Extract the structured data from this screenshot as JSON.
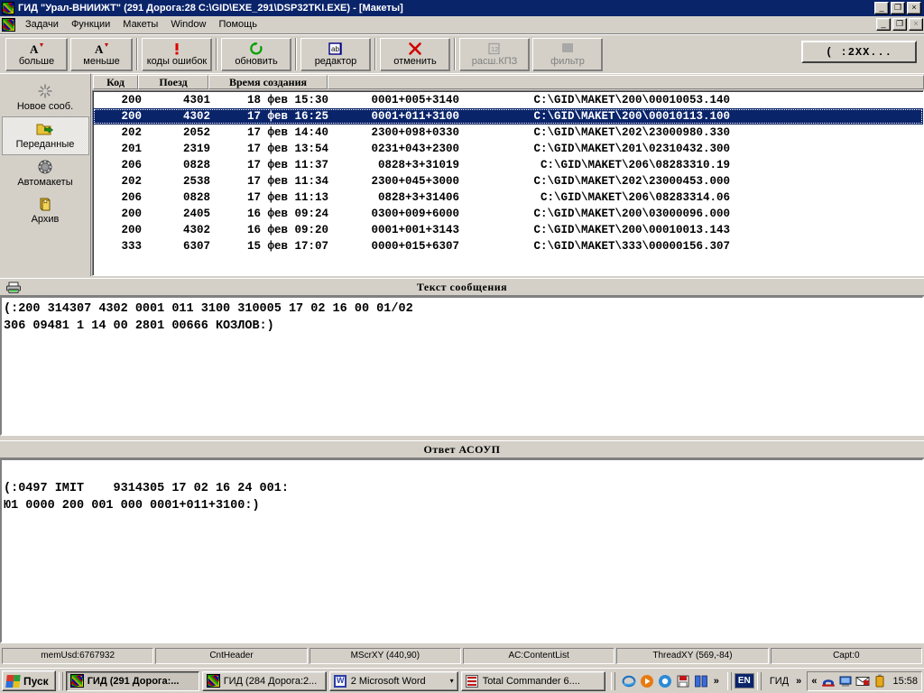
{
  "window": {
    "title": "ГИД \"Урал-ВНИИЖТ\" (291 Дорога:28 C:\\GID\\EXE_291\\DSP32TKI.EXE) - [Макеты]",
    "minimize_label": "_",
    "restore_label": "❐",
    "close_label": "×",
    "mdi_restore_label": "❐",
    "mdi_close_label": "×",
    "mdi_minimize_label": "_"
  },
  "menu": {
    "items": [
      {
        "label": "Задачи"
      },
      {
        "label": "Функции"
      },
      {
        "label": "Макеты"
      },
      {
        "label": "Window"
      },
      {
        "label": "Помощь"
      }
    ]
  },
  "toolbar": {
    "buttons": [
      {
        "label": "больше",
        "icon": "font-increase-icon",
        "glyph": "A▴",
        "disabled": false
      },
      {
        "label": "меньше",
        "icon": "font-decrease-icon",
        "glyph": "A▾",
        "disabled": false
      },
      {
        "label": "коды ошибок",
        "icon": "exclamation-icon",
        "glyph": "!",
        "disabled": false
      },
      {
        "label": "обновить",
        "icon": "refresh-icon",
        "glyph": "↺",
        "disabled": false
      },
      {
        "label": "редактор",
        "icon": "text-editor-icon",
        "glyph": "ab",
        "disabled": false
      },
      {
        "label": "отменить",
        "icon": "cancel-x-icon",
        "glyph": "✕",
        "disabled": false
      },
      {
        "label": "расш.КПЗ",
        "icon": "number-box-icon",
        "glyph": "12",
        "disabled": true
      },
      {
        "label": "фильтр",
        "icon": "grid-filter-icon",
        "glyph": "▒",
        "disabled": true
      }
    ],
    "command_box_value": "( :2XX..."
  },
  "nav": {
    "items": [
      {
        "label": "Новое сооб.",
        "icon": "new-message-icon",
        "glyph": "✸",
        "selected": false
      },
      {
        "label": "Переданные",
        "icon": "sent-folder-icon",
        "glyph": "➡",
        "selected": true
      },
      {
        "label": "Автомакеты",
        "icon": "gear-icon",
        "glyph": "⚙",
        "selected": false
      },
      {
        "label": "Архив",
        "icon": "archive-icon",
        "glyph": "὜4",
        "selected": false
      }
    ]
  },
  "list": {
    "columns": [
      {
        "label": "Код"
      },
      {
        "label": "Поезд"
      },
      {
        "label": "Время создания"
      },
      {
        "label": ""
      }
    ],
    "rows": [
      {
        "code": "200",
        "train": "4301",
        "time": "18 фев 15:30",
        "index": "0001+005+3140",
        "path": "C:\\GID\\MAKET\\200\\00010053.140",
        "selected": false
      },
      {
        "code": "200",
        "train": "4302",
        "time": "17 фев 16:25",
        "index": "0001+011+3100",
        "path": "C:\\GID\\MAKET\\200\\00010113.100",
        "selected": true
      },
      {
        "code": "202",
        "train": "2052",
        "time": "17 фев 14:40",
        "index": "2300+098+0330",
        "path": "C:\\GID\\MAKET\\202\\23000980.330",
        "selected": false
      },
      {
        "code": "201",
        "train": "2319",
        "time": "17 фев 13:54",
        "index": "0231+043+2300",
        "path": "C:\\GID\\MAKET\\201\\02310432.300",
        "selected": false
      },
      {
        "code": "206",
        "train": "0828",
        "time": "17 фев 11:37",
        "index": "0828+3+31019",
        "path": "C:\\GID\\MAKET\\206\\08283310.19",
        "selected": false
      },
      {
        "code": "202",
        "train": "2538",
        "time": "17 фев 11:34",
        "index": "2300+045+3000",
        "path": "C:\\GID\\MAKET\\202\\23000453.000",
        "selected": false
      },
      {
        "code": "206",
        "train": "0828",
        "time": "17 фев 11:13",
        "index": "0828+3+31406",
        "path": "C:\\GID\\MAKET\\206\\08283314.06",
        "selected": false
      },
      {
        "code": "200",
        "train": "2405",
        "time": "16 фев 09:24",
        "index": "0300+009+6000",
        "path": "C:\\GID\\MAKET\\200\\03000096.000",
        "selected": false
      },
      {
        "code": "200",
        "train": "4302",
        "time": "16 фев 09:20",
        "index": "0001+001+3143",
        "path": "C:\\GID\\MAKET\\200\\00010013.143",
        "selected": false
      },
      {
        "code": "333",
        "train": "6307",
        "time": "15 фев 17:07",
        "index": "0000+015+6307",
        "path": "C:\\GID\\MAKET\\333\\00000156.307",
        "selected": false
      }
    ]
  },
  "message_panel": {
    "title": "Текст сообщения",
    "print_icon": "printer-icon",
    "text": "(:200 314307 4302 0001 011 3100 310005 17 02 16 00 01/02\n306 09481 1 14 00 2801 00666 КОЗЛОВ:)"
  },
  "response_panel": {
    "title": "Ответ АСОУП",
    "text": "\n(:0497 IMIT    9314305 17 02 16 24 001:\nЮ1 0000 200 001 000 0001+011+3100:)"
  },
  "statusbar": {
    "cells": [
      {
        "label": "memUsd:6767932"
      },
      {
        "label": "CntHeader"
      },
      {
        "label": "MScrXY (440,90)"
      },
      {
        "label": "AC:ContentList"
      },
      {
        "label": "ThreadXY (569,-84)"
      },
      {
        "label": "Capt:0"
      }
    ]
  },
  "taskbar": {
    "start_label": "Пуск",
    "tasks": [
      {
        "label": "ГИД (291 Дорога:...",
        "icon": "gid-icon",
        "active": true,
        "caret": ""
      },
      {
        "label": "ГИД (284 Дорога:2...",
        "icon": "gid-icon",
        "active": false,
        "caret": ""
      },
      {
        "label": "2 Microsoft Word",
        "icon": "word-icon",
        "active": false,
        "caret": "▾"
      },
      {
        "label": "Total Commander 6....",
        "icon": "total-commander-icon",
        "active": false,
        "caret": ""
      }
    ],
    "quicklaunch": [
      {
        "icon": "internet-explorer-icon",
        "glyph": "℮"
      },
      {
        "icon": "media-player-icon",
        "glyph": "▶"
      },
      {
        "icon": "browser-icon",
        "glyph": "◉"
      },
      {
        "icon": "save-disk-icon",
        "glyph": "▤"
      },
      {
        "icon": "windows-panels-icon",
        "glyph": "▥"
      }
    ],
    "quicklaunch_chevron": "»",
    "language": "EN",
    "gid_band_label": "ГИД",
    "gid_band_chevron": "»",
    "tray_chevron": "«",
    "tray_icons": [
      {
        "icon": "modem-phone-icon",
        "glyph": "☎"
      },
      {
        "icon": "network-icon",
        "glyph": "Ὓ3"
      },
      {
        "icon": "mail-icon",
        "glyph": "✉"
      },
      {
        "icon": "battery-icon",
        "glyph": "ὐb"
      }
    ],
    "clock": "15:58"
  },
  "colors": {
    "face": "#d4d0c8",
    "titlebar": "#0a246a",
    "selection": "#0a246a",
    "text": "#000000"
  }
}
